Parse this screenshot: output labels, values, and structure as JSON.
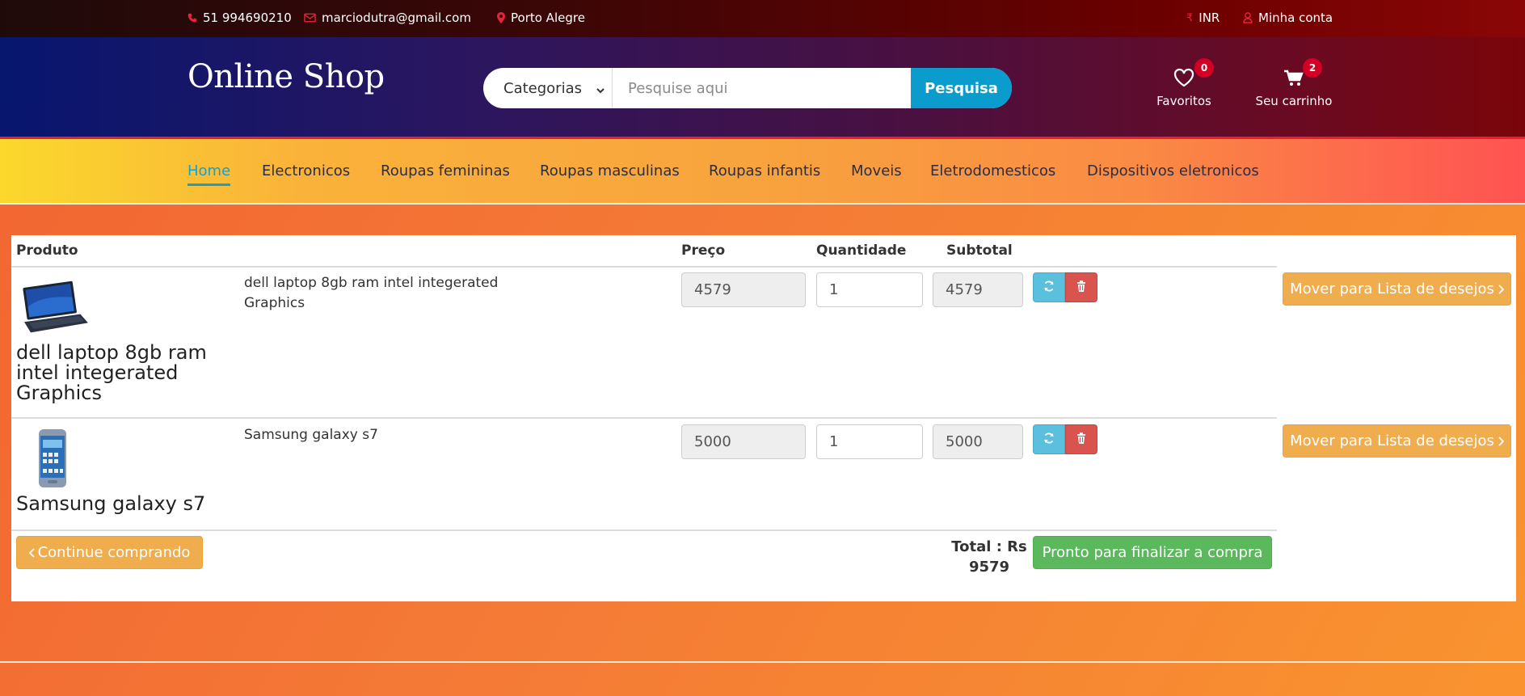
{
  "topbar": {
    "phone": "51 994690210",
    "email": "marciodutra@gmail.com",
    "location": "Porto Alegre",
    "currency": "INR",
    "account": "Minha conta"
  },
  "header": {
    "logo": "Online Shop",
    "category_select": "Categorias",
    "search_placeholder": "Pesquise aqui",
    "search_button": "Pesquisa",
    "wishlist_label": "Favoritos",
    "wishlist_count": "0",
    "cart_label": "Seu carrinho",
    "cart_count": "2"
  },
  "nav": {
    "items": [
      "Home",
      "Electronicos",
      "Roupas femininas",
      "Roupas masculinas",
      "Roupas infantis",
      "Moveis",
      "Eletrodomesticos",
      "Dispositivos eletronicos"
    ],
    "active": "Home"
  },
  "cart": {
    "headers": {
      "product": "Produto",
      "price": "Preço",
      "quantity": "Quantidade",
      "subtotal": "Subtotal"
    },
    "items": [
      {
        "name": "dell laptop 8gb ram intel integerated Graphics",
        "description": "dell laptop 8gb ram intel integerated Graphics",
        "price": "4579",
        "quantity": "1",
        "subtotal": "4579",
        "move_label": "Mover para Lista de desejos"
      },
      {
        "name": "Samsung galaxy s7",
        "description": "Samsung galaxy s7",
        "price": "5000",
        "quantity": "1",
        "subtotal": "5000",
        "move_label": "Mover para Lista de desejos"
      }
    ],
    "continue_label": "Continue comprando",
    "total_label": "Total : Rs",
    "total_value": "9579",
    "checkout_label": "Pronto para finalizar a compra"
  },
  "colors": {
    "accent": "#d10024",
    "search_button": "#0a9ccc",
    "warning_button": "#f0ad4e",
    "success_button": "#5cb85c",
    "refresh_button": "#5bc0de",
    "delete_button": "#d9534f"
  }
}
